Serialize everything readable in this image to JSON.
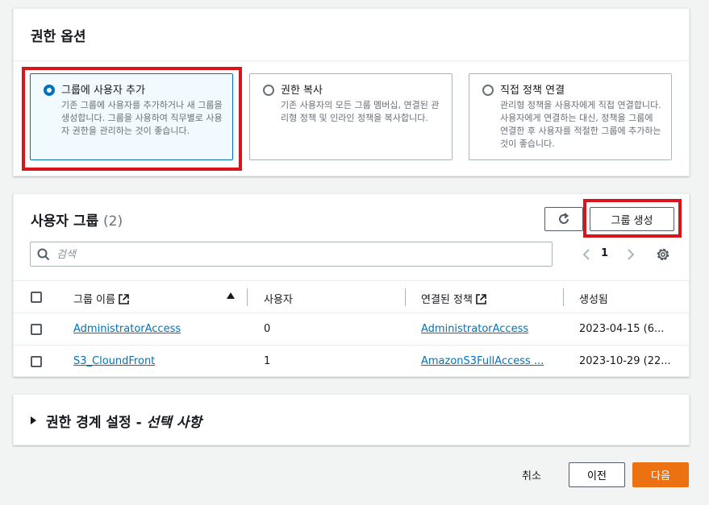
{
  "permission_options": {
    "title": "권한 옵션",
    "tiles": [
      {
        "title": "그룹에 사용자 추가",
        "description": "기존 그룹에 사용자를 추가하거나 새 그룹을 생성합니다. 그룹을 사용하여 직무별로 사용자 권한을 관리하는 것이 좋습니다.",
        "selected": true
      },
      {
        "title": "권한 복사",
        "description": "기존 사용자의 모든 그룹 멤버십, 연결된 관리형 정책 및 인라인 정책을 복사합니다.",
        "selected": false
      },
      {
        "title": "직접 정책 연결",
        "description": "관리형 정책을 사용자에게 직접 연결합니다. 사용자에게 연결하는 대신, 정책을 그룹에 연결한 후 사용자를 적절한 그룹에 추가하는 것이 좋습니다.",
        "selected": false
      }
    ]
  },
  "groups": {
    "title": "사용자 그룹",
    "count": "(2)",
    "create_button": "그룹 생성",
    "search_placeholder": "검색",
    "current_page": "1",
    "columns": {
      "name": "그룹 이름",
      "users": "사용자",
      "policies": "연결된 정책",
      "created": "생성됨"
    },
    "rows": [
      {
        "name": "AdministratorAccess",
        "users": "0",
        "policy": "AdministratorAccess",
        "created": "2023-04-15 (6..."
      },
      {
        "name": "S3_CloundFront",
        "users": "1",
        "policy": "AmazonS3FullAccess ...",
        "created": "2023-10-29 (22..."
      }
    ]
  },
  "boundary": {
    "title": "권한 경계 설정 - ",
    "optional": "선택 사항"
  },
  "footer": {
    "cancel": "취소",
    "previous": "이전",
    "next": "다음"
  },
  "colors": {
    "accent": "#0073bb",
    "primary_button": "#ec7211",
    "highlight_box": "#d9141b"
  }
}
